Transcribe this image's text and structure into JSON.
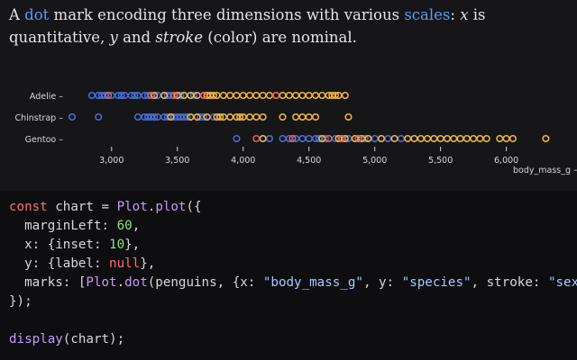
{
  "intro": {
    "p1": "A ",
    "link_dot": "dot",
    "p2": " mark encoding three dimensions with various ",
    "link_scales": "scales",
    "p3": ": ",
    "x": "x",
    "p4": " is quantitative, ",
    "y": "y",
    "p5": " and ",
    "stroke": "stroke",
    "p6": " (color) are nominal."
  },
  "colors": {
    "female": "#4c6fd6",
    "male": "#f2b73f",
    "missing": "#e45f5f",
    "background": "#161618",
    "code_background": "#0e0e10"
  },
  "chart_data": {
    "type": "scatter",
    "xlabel": "body_mass_g →",
    "xlim": [
      2700,
      6400
    ],
    "x_ticks": [
      3000,
      3500,
      4000,
      4500,
      5000,
      5500,
      6000
    ],
    "x_tick_labels": [
      "3,000",
      "3,500",
      "4,000",
      "4,500",
      "5,000",
      "5,500",
      "6,000"
    ],
    "categories": [
      "Adelie",
      "Chinstrap",
      "Gentoo"
    ],
    "category_labels": [
      "Adelie –",
      "Chinstrap –",
      "Gentoo –"
    ],
    "grid": false,
    "series": [
      {
        "category": "Adelie",
        "female": [
          2850,
          2900,
          2925,
          2950,
          2975,
          3000,
          3050,
          3075,
          3100,
          3150,
          3175,
          3200,
          3250,
          3275,
          3300,
          3325,
          3350,
          3400,
          3425,
          3450,
          3475,
          3500,
          3525,
          3550,
          3600,
          3625,
          3650,
          3700,
          3725,
          3750
        ],
        "male": [
          3325,
          3400,
          3500,
          3550,
          3600,
          3650,
          3700,
          3725,
          3750,
          3775,
          3800,
          3850,
          3900,
          3950,
          4000,
          4050,
          4100,
          4150,
          4200,
          4250,
          4300,
          4350,
          4400,
          4450,
          4500,
          4550,
          4600,
          4650,
          4675,
          4700,
          4725,
          4775
        ],
        "missing": [
          2975,
          3300,
          3475,
          3700,
          4250
        ]
      },
      {
        "category": "Chinstrap",
        "female": [
          2700,
          2900,
          3200,
          3250,
          3275,
          3300,
          3325,
          3350,
          3400,
          3425,
          3450,
          3475,
          3500,
          3525,
          3550,
          3575,
          3600,
          3650,
          3675,
          3700,
          3725,
          3775,
          3800,
          3900
        ],
        "male": [
          3450,
          3600,
          3650,
          3725,
          3800,
          3825,
          3850,
          3900,
          3950,
          3975,
          4000,
          4050,
          4100,
          4150,
          4300,
          4400,
          4450,
          4500,
          4550,
          4800
        ]
      },
      {
        "category": "Gentoo",
        "female": [
          3950,
          4150,
          4200,
          4300,
          4350,
          4375,
          4400,
          4450,
          4500,
          4550,
          4575,
          4600,
          4625,
          4650,
          4700,
          4725,
          4750,
          4775,
          4800,
          4850,
          4875,
          4900,
          4925,
          4950,
          5000,
          5050,
          5100,
          5200
        ],
        "male": [
          4150,
          4600,
          4725,
          4750,
          4775,
          4850,
          4875,
          4900,
          4950,
          5050,
          5150,
          5250,
          5300,
          5350,
          5400,
          5450,
          5500,
          5550,
          5600,
          5650,
          5700,
          5750,
          5800,
          5850,
          5950,
          6000,
          6050,
          6300
        ],
        "missing": [
          4100,
          4375,
          4650,
          4750,
          4875
        ]
      }
    ]
  },
  "code": {
    "lines": [
      [
        [
          "kw",
          "const"
        ],
        [
          "p",
          " chart = "
        ],
        [
          "fn",
          "Plot"
        ],
        [
          "p",
          "."
        ],
        [
          "fn",
          "plot"
        ],
        [
          "p",
          "({"
        ]
      ],
      [
        [
          "p",
          "  marginLeft: "
        ],
        [
          "num",
          "60"
        ],
        [
          "p",
          ","
        ]
      ],
      [
        [
          "p",
          "  x: {inset: "
        ],
        [
          "num",
          "10"
        ],
        [
          "p",
          "},"
        ]
      ],
      [
        [
          "p",
          "  y: {label: "
        ],
        [
          "kw",
          "null"
        ],
        [
          "p",
          "},"
        ]
      ],
      [
        [
          "p",
          "  marks: ["
        ],
        [
          "fn",
          "Plot"
        ],
        [
          "p",
          "."
        ],
        [
          "fn",
          "dot"
        ],
        [
          "p",
          "(penguins, {x: "
        ],
        [
          "str",
          "\"body_mass_g\""
        ],
        [
          "p",
          ", y: "
        ],
        [
          "str",
          "\"species\""
        ],
        [
          "p",
          ", stroke: "
        ],
        [
          "str",
          "\"sex\""
        ],
        [
          "p",
          "})]"
        ]
      ],
      [
        [
          "p",
          "});"
        ]
      ],
      [
        [
          "p",
          ""
        ]
      ],
      [
        [
          "fn",
          "display"
        ],
        [
          "p",
          "(chart);"
        ]
      ]
    ]
  }
}
